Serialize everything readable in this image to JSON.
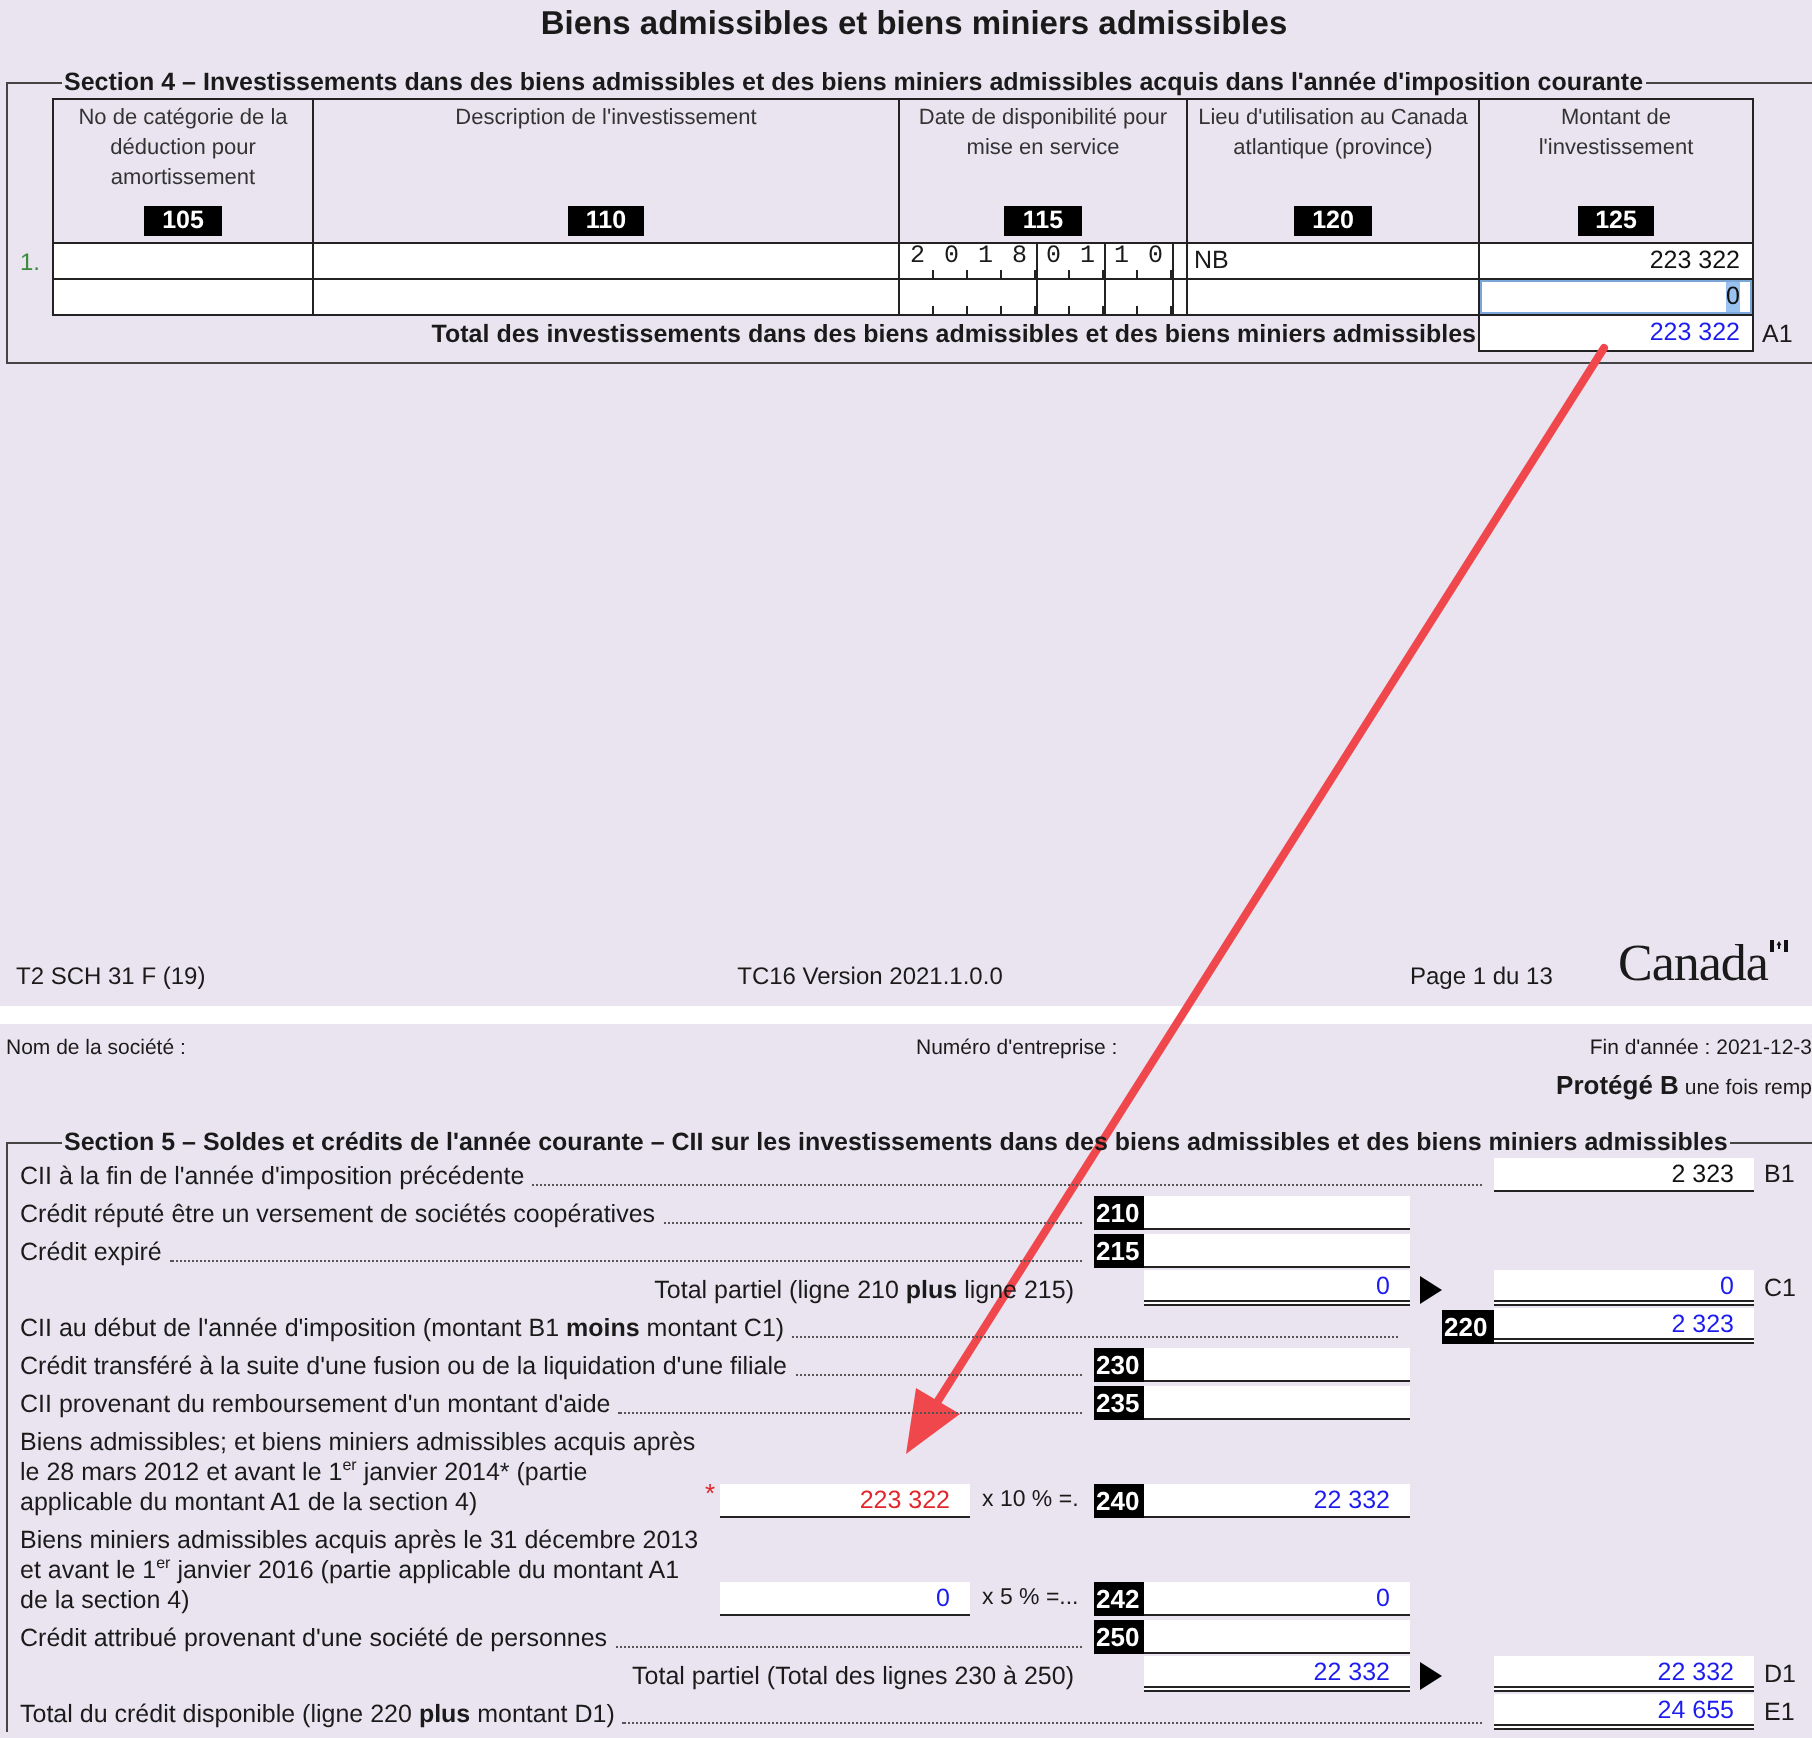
{
  "title": "Biens admissibles et biens miniers admissibles",
  "section4": {
    "legend": "Section 4 – Investissements dans des biens admissibles et des biens miniers admissibles acquis dans l'année d'imposition courante",
    "columns": [
      {
        "label": "No de catégorie de la déduction pour amortissement",
        "code": "105"
      },
      {
        "label": "Description de l'investissement",
        "code": "110"
      },
      {
        "label": "Date de disponibilité pour mise en service",
        "code": "115"
      },
      {
        "label": "Lieu d'utilisation au Canada atlantique (province)",
        "code": "120"
      },
      {
        "label": "Montant de l'investissement",
        "code": "125"
      }
    ],
    "rows": [
      {
        "number": "1.",
        "date": "20180110",
        "province": "NB",
        "amount": {
          "text": "223 322",
          "calculated": false
        },
        "selected": false
      },
      {
        "amount": {
          "text": "0",
          "calculated": false
        },
        "selected": true
      }
    ],
    "total": {
      "label": "Total des investissements dans des biens admissibles et des biens miniers admissibles",
      "value": {
        "text": "223 322",
        "calculated": true
      },
      "letter": "A1"
    }
  },
  "footer": {
    "form": "T2 SCH 31 F (19)",
    "version": "TC16 Version 2021.1.0.0",
    "page": "Page 1 du 13",
    "logo": "Canada"
  },
  "page_header": {
    "company": "Nom de la société :",
    "business_number": "Numéro d'entreprise :",
    "year_end": "Fin d'année : 2021-12-3",
    "protected": "**Protégé B** une fois remp"
  },
  "section5": {
    "legend": "Section 5 – Soldes et crédits de l'année courante – CII sur les investissements dans des biens admissibles et des biens miniers admissibles",
    "rows": [
      {
        "kind": "right",
        "label": "CII à la fin de l'année d'imposition précédente",
        "carried": {
          "text": "2 323",
          "calculated": false
        },
        "letter": "B1"
      },
      {
        "kind": "coded",
        "label": "Crédit réputé être un versement de sociétés coopératives",
        "code": "210"
      },
      {
        "kind": "coded",
        "label": "Crédit expiré",
        "code": "215"
      },
      {
        "kind": "subtotal",
        "label": "Total partiel (ligne 210 **plus** ligne 215)",
        "amount": {
          "text": "0",
          "calculated": true
        },
        "carried": {
          "text": "0",
          "calculated": true
        },
        "letter": "C1"
      },
      {
        "kind": "total",
        "label": "CII au début de l'année d'imposition (montant B1 **moins** montant C1)",
        "code": "220",
        "carried": {
          "text": "2 323",
          "calculated": true
        }
      },
      {
        "kind": "coded",
        "label": "Crédit transféré à la suite d'une fusion ou de la liquidation d'une filiale",
        "code": "230"
      },
      {
        "kind": "coded",
        "label": "CII provenant du remboursement d'un montant d'aide",
        "code": "235"
      },
      {
        "kind": "multiply",
        "label": "Biens admissibles; et biens miniers admissibles acquis après le 28 mars 2012 et avant le 1$^{er}$ janvier 2014* (partie applicable du montant A1 de la section 4)",
        "base": {
          "text": "223 322",
          "flagged": true,
          "marker": "*"
        },
        "rate": "x 10 % =.",
        "code": "240",
        "amount": {
          "text": "22 332",
          "calculated": true
        }
      },
      {
        "kind": "multiply",
        "label": "Biens miniers admissibles acquis après le 31 décembre 2013 et avant le 1$^{er}$ janvier 2016 (partie applicable du montant A1 de la section 4)",
        "base": {
          "text": "0",
          "calculated": true,
          "flagged": false
        },
        "rate": "x 5 % =...",
        "code": "242",
        "amount": {
          "text": "0",
          "calculated": true
        }
      },
      {
        "kind": "coded",
        "label": "Crédit attribué provenant d'une société de personnes",
        "code": "250"
      },
      {
        "kind": "subtotal",
        "label": "Total partiel (Total des lignes 230 à 250)",
        "amount": {
          "text": "22 332",
          "calculated": true
        },
        "carried": {
          "text": "22 332",
          "calculated": true
        },
        "letter": "D1"
      },
      {
        "kind": "total",
        "label": "Total du crédit disponible (ligne 220 **plus** montant D1)",
        "carried": {
          "text": "24 655",
          "calculated": true
        },
        "letter": "E1"
      }
    ]
  }
}
